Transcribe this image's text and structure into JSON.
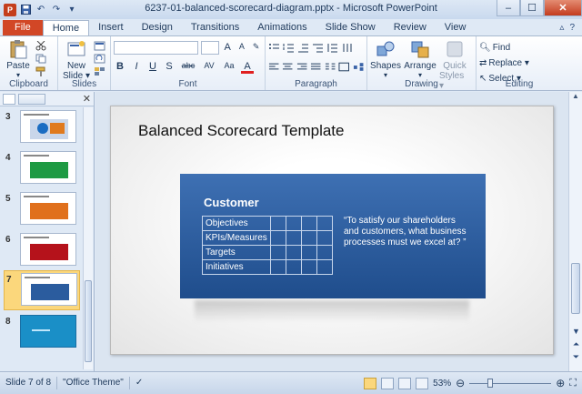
{
  "window": {
    "title": "6237-01-balanced-scorecard-diagram.pptx - Microsoft PowerPoint",
    "app_icon_letter": "P",
    "controls": [
      "–",
      "☐",
      "✕"
    ]
  },
  "ribbon_tabs": [
    "File",
    "Home",
    "Insert",
    "Design",
    "Transitions",
    "Animations",
    "Slide Show",
    "Review",
    "View"
  ],
  "active_tab": "Home",
  "ribbon": {
    "clipboard": {
      "paste": "Paste",
      "label": "Clipboard"
    },
    "slides": {
      "new_slide": "New",
      "new_slide_2": "Slide ▾",
      "label": "Slides"
    },
    "font": {
      "label": "Font",
      "bold": "B",
      "italic": "I",
      "underline": "U",
      "strike": "S",
      "abc": "abc",
      "av": "AV",
      "aa": "Aa",
      "font_color": "A"
    },
    "paragraph": {
      "label": "Paragraph"
    },
    "drawing": {
      "shapes": "Shapes",
      "arrange": "Arrange",
      "quick_styles": "Quick",
      "quick_styles_2": "Styles ▾",
      "label": "Drawing"
    },
    "editing": {
      "find": "Find",
      "replace": "Replace ▾",
      "select": "Select ▾",
      "label": "Editing"
    }
  },
  "slide_pane": {
    "thumbnails": [
      {
        "num": "3",
        "color": "#c9d6ea"
      },
      {
        "num": "4",
        "color": "#1e9a43"
      },
      {
        "num": "5",
        "color": "#e0701c"
      },
      {
        "num": "6",
        "color": "#b5121b"
      },
      {
        "num": "7",
        "color": "#2b5c9e"
      },
      {
        "num": "8",
        "color": "#1a8fc7"
      }
    ],
    "selected": "7"
  },
  "slide": {
    "title": "Balanced Scorecard Template",
    "panel_heading": "Customer",
    "rows": [
      "Objectives",
      "KPIs/Measures",
      "Targets",
      "Initiatives"
    ],
    "quote": "“To satisfy our shareholders and customers, what business processes must we excel at? ”"
  },
  "status": {
    "slide_info": "Slide 7 of 8",
    "theme": "\"Office Theme\"",
    "zoom": "53%",
    "zoom_level_percent": 53
  }
}
